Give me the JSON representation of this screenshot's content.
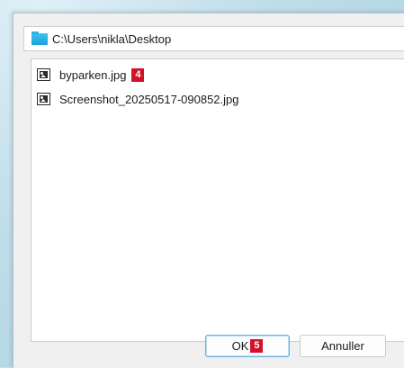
{
  "path_bar": {
    "icon": "folder-icon",
    "text": "C:\\Users\\nikla\\Desktop"
  },
  "files": [
    {
      "name": "byparken.jpg",
      "icon": "image-file-icon",
      "badge": "4"
    },
    {
      "name": "Screenshot_20250517-090852.jpg",
      "icon": "image-file-icon"
    }
  ],
  "buttons": {
    "ok_label": "OK",
    "ok_badge": "5",
    "cancel_label": "Annuller"
  },
  "colors": {
    "badge": "#d3122a",
    "folder": "#16a3db",
    "ok_border": "#6ab0de"
  }
}
